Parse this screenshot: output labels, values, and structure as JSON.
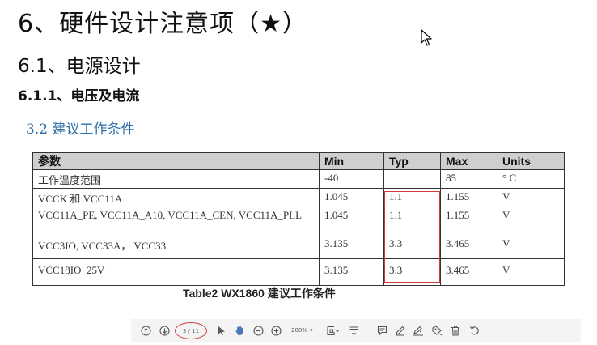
{
  "headings": {
    "h1": "6、硬件设计注意项（★）",
    "h2": "6.1、电源设计",
    "h3": "6.1.1、电压及电流",
    "h4": "3.2 建议工作条件"
  },
  "table": {
    "headers": [
      "参数",
      "Min",
      "Typ",
      "Max",
      "Units"
    ],
    "rows": [
      [
        "工作温度范围",
        "-40",
        "",
        "85",
        "° C"
      ],
      [
        "VCCK 和 VCC11A",
        "1.045",
        "1.1",
        "1.155",
        "V"
      ],
      [
        "VCC11A_PE, VCC11A_A10, VCC11A_CEN, VCC11A_PLL",
        "1.045",
        "1.1",
        "1.155",
        "V"
      ],
      [
        "VCC3IO, VCC33A， VCC33",
        "3.135",
        "3.3",
        "3.465",
        "V"
      ],
      [
        "VCC18IO_25V",
        "3.135",
        "3.3",
        "3.465",
        "V"
      ]
    ],
    "caption": "Table2  WX1860 建议工作条件"
  },
  "toolbar": {
    "page_indicator": "3 / 11",
    "zoom": "200%",
    "highlight_color": "#d0393a",
    "icons": [
      "arrow-up-circle-icon",
      "arrow-down-circle-icon",
      "select-cursor-icon",
      "hand-tool-icon",
      "zoom-out-icon",
      "zoom-in-icon",
      "fit-page-icon",
      "scroll-mode-icon",
      "comment-icon",
      "pen-icon",
      "sign-icon",
      "stamp-icon",
      "delete-icon",
      "undo-icon"
    ]
  }
}
